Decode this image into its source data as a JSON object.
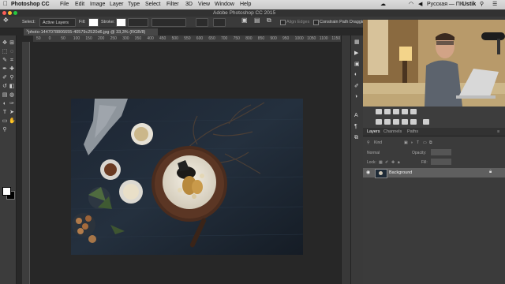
{
  "menubar": {
    "app_name": "Photoshop CC",
    "items": [
      "File",
      "Edit",
      "Image",
      "Layer",
      "Type",
      "Select",
      "Filter",
      "3D",
      "View",
      "Window",
      "Help"
    ],
    "keyboard_layout": "Русская — ПК",
    "user_name": "Ustik"
  },
  "window": {
    "title": "Adobe Photoshop CC 2015"
  },
  "options_bar": {
    "select_label": "Select:",
    "select_value": "Active Layers",
    "fill_label": "Fill:",
    "stroke_label": "Stroke:",
    "align_edges_label": "Align Edges",
    "constrain_label": "Constrain Path Dragging"
  },
  "document": {
    "tab_title": "photo-1447078806655-40579c2520d6.jpg @ 33,3% (RGB/8)"
  },
  "ruler": {
    "marks": [
      "50",
      "0",
      "50",
      "100",
      "150",
      "200",
      "250",
      "300",
      "350",
      "400",
      "450",
      "500",
      "550",
      "600",
      "650",
      "700",
      "750",
      "800",
      "850",
      "900",
      "950",
      "1000",
      "1050",
      "1100",
      "1150"
    ]
  },
  "tools": [
    {
      "name": "move-tool-icon",
      "glyph": "✥"
    },
    {
      "name": "artboard-tool-icon",
      "glyph": "⊞"
    },
    {
      "name": "marquee-tool-icon",
      "glyph": "⬚"
    },
    {
      "name": "lasso-tool-icon",
      "glyph": "◌"
    },
    {
      "name": "quick-select-tool-icon",
      "glyph": "✎"
    },
    {
      "name": "crop-tool-icon",
      "glyph": "⌗"
    },
    {
      "name": "eyedropper-tool-icon",
      "glyph": "✒"
    },
    {
      "name": "healing-brush-tool-icon",
      "glyph": "✚"
    },
    {
      "name": "brush-tool-icon",
      "glyph": "✐"
    },
    {
      "name": "clone-stamp-tool-icon",
      "glyph": "⚲"
    },
    {
      "name": "history-brush-tool-icon",
      "glyph": "↺"
    },
    {
      "name": "eraser-tool-icon",
      "glyph": "◧"
    },
    {
      "name": "gradient-tool-icon",
      "glyph": "▤"
    },
    {
      "name": "blur-tool-icon",
      "glyph": "◍"
    },
    {
      "name": "dodge-tool-icon",
      "glyph": "◐"
    },
    {
      "name": "pen-tool-icon",
      "glyph": "✑"
    },
    {
      "name": "type-tool-icon",
      "glyph": "T"
    },
    {
      "name": "path-select-tool-icon",
      "glyph": "➤"
    },
    {
      "name": "shape-tool-icon",
      "glyph": "▭"
    },
    {
      "name": "hand-tool-icon",
      "glyph": "✋"
    },
    {
      "name": "zoom-tool-icon",
      "glyph": "⚲"
    }
  ],
  "layers_panel": {
    "tabs": [
      "Layers",
      "Channels",
      "Paths"
    ],
    "kind_label": "Kind",
    "blend_mode": "Normal",
    "opacity_label": "Opacity:",
    "lock_label": "Lock:",
    "fill_label": "Fill:",
    "layer_name": "Background"
  },
  "colors": {
    "menubar": "#d4d4d4",
    "panel": "#3b3b3b",
    "canvas_bg": "#272727",
    "photo_bg": "#1e2a36",
    "selected_layer": "#5f5f5f"
  }
}
